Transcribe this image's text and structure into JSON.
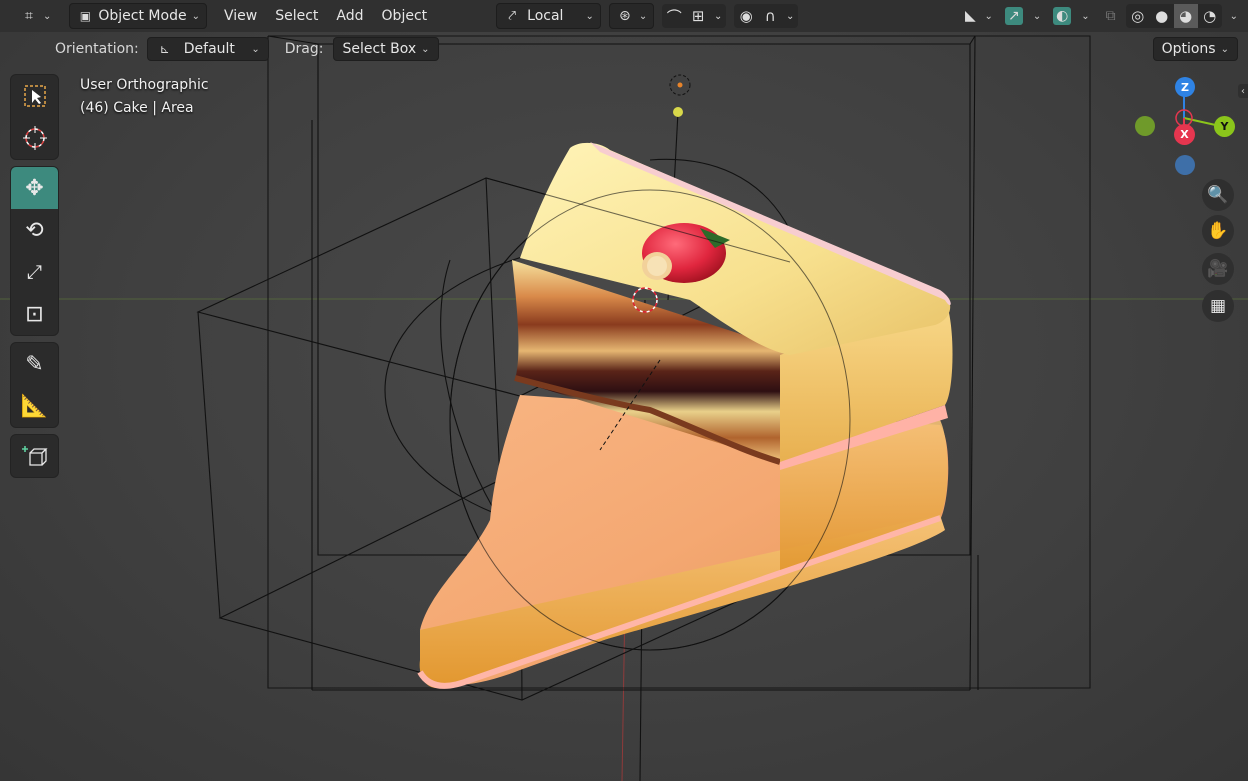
{
  "header": {
    "editor_type_icon": "editor-type-icon",
    "mode_label": "Object Mode",
    "menus": [
      "View",
      "Select",
      "Add",
      "Object"
    ],
    "transform_orientation": "Local",
    "pivot_icon": "pivot-icon",
    "snap_icon": "snap-icon",
    "snap_increment_icon": "snap-increment-icon",
    "proportional_icon": "proportional-editing-icon",
    "falloff_icon": "falloff-icon",
    "visibility_icon": "visibility-icon",
    "gizmo_icon": "gizmo-icon",
    "overlay_icon": "overlay-icon",
    "xray_icon": "xray-icon",
    "shading_modes": [
      "wireframe",
      "solid",
      "material-preview",
      "rendered"
    ],
    "active_shading": "material-preview"
  },
  "tool_settings": {
    "orientation_label": "Orientation:",
    "orientation_value": "Default",
    "drag_label": "Drag:",
    "drag_value": "Select Box",
    "options_label": "Options"
  },
  "viewport": {
    "view_name": "User Orthographic",
    "object_info": "(46) Cake | Area"
  },
  "toolbar": [
    {
      "name": "select-box-tool",
      "active": false
    },
    {
      "name": "cursor-tool",
      "active": false
    },
    {
      "name": "move-tool",
      "active": true
    },
    {
      "name": "rotate-tool",
      "active": false
    },
    {
      "name": "scale-tool",
      "active": false
    },
    {
      "name": "transform-tool",
      "active": false
    },
    {
      "name": "annotate-tool",
      "active": false
    },
    {
      "name": "measure-tool",
      "active": false
    },
    {
      "name": "add-cube-tool",
      "active": false
    }
  ],
  "nav_gizmo": {
    "z_label": "Z",
    "x_label": "X",
    "y_label": "Y",
    "colors": {
      "z": "#2f83e4",
      "x": "#e6364f",
      "y": "#8bc51b"
    }
  },
  "nav_buttons": [
    "zoom-icon",
    "hand-pan-icon",
    "camera-icon",
    "grid-icon"
  ],
  "colors": {
    "accent": "#3d8a7e",
    "header_bg": "#303030",
    "viewport_bg": "#404040"
  }
}
